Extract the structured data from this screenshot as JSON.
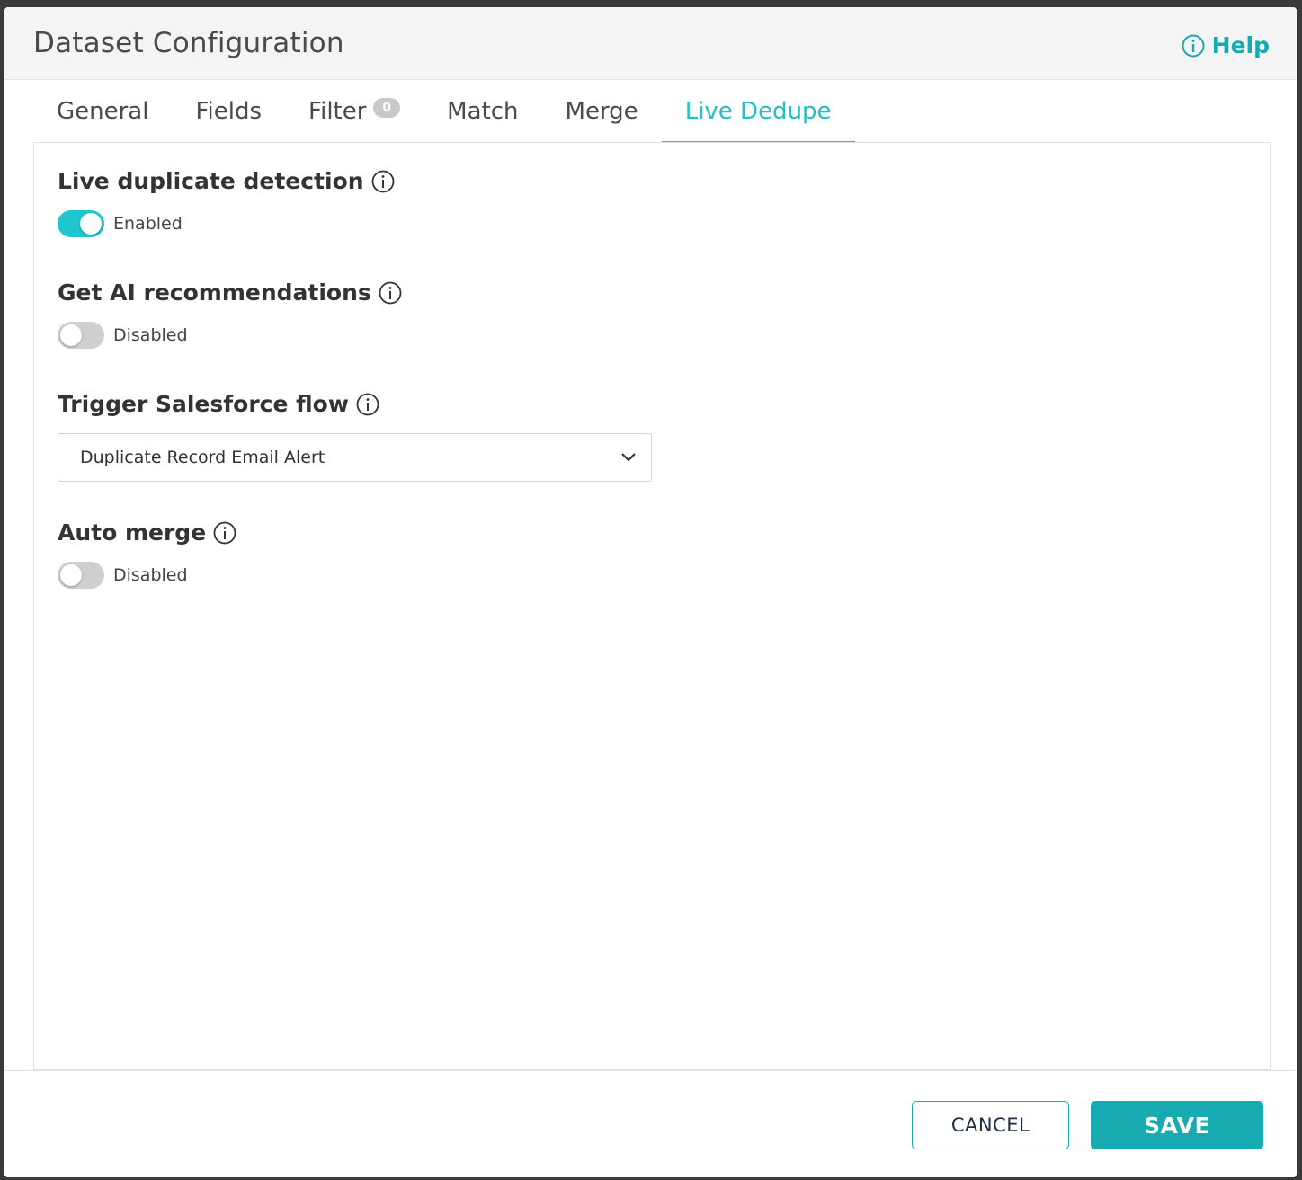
{
  "header": {
    "title": "Dataset Configuration",
    "help_label": "Help"
  },
  "tabs": [
    {
      "label": "General"
    },
    {
      "label": "Fields"
    },
    {
      "label": "Filter",
      "badge": "0"
    },
    {
      "label": "Match"
    },
    {
      "label": "Merge"
    },
    {
      "label": "Live Dedupe",
      "active": true
    }
  ],
  "live_dedupe": {
    "live_detection": {
      "title": "Live duplicate detection",
      "state_label": "Enabled",
      "enabled": true
    },
    "ai_recommendations": {
      "title": "Get AI recommendations",
      "state_label": "Disabled",
      "enabled": false
    },
    "salesforce_flow": {
      "title": "Trigger Salesforce flow",
      "selected_value": "Duplicate Record Email Alert"
    },
    "auto_merge": {
      "title": "Auto merge",
      "state_label": "Disabled",
      "enabled": false
    }
  },
  "footer": {
    "cancel_label": "CANCEL",
    "save_label": "SAVE"
  },
  "colors": {
    "accent": "#17aab0",
    "toggle_on": "#1fc7cc",
    "toggle_off": "#cfcfcf"
  }
}
